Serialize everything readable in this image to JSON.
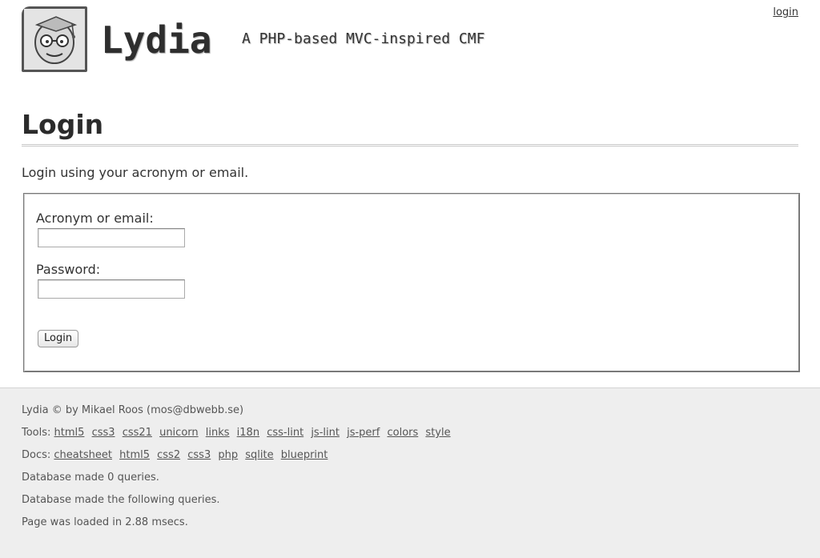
{
  "header": {
    "site_title": "Lydia",
    "slogan": "A PHP-based MVC-inspired CMF",
    "login_link": "login",
    "logo_icon": "nerd-face-with-graduation-cap-icon"
  },
  "main": {
    "title": "Login",
    "intro": "Login using your acronym or email.",
    "form": {
      "acronym_label": "Acronym or email:",
      "acronym_value": "",
      "password_label": "Password:",
      "password_value": "",
      "submit_label": "Login"
    }
  },
  "footer": {
    "copyright": "Lydia © by Mikael Roos (mos@dbwebb.se)",
    "tools_label": "Tools:",
    "tools": [
      "html5",
      "css3",
      "css21",
      "unicorn",
      "links",
      "i18n",
      "css-lint",
      "js-lint",
      "js-perf",
      "colors",
      "style"
    ],
    "docs_label": "Docs:",
    "docs": [
      "cheatsheet",
      "html5",
      "css2",
      "css3",
      "php",
      "sqlite",
      "blueprint"
    ],
    "db_queries": "Database made 0 queries.",
    "db_following": "Database made the following queries.",
    "load_time": "Page was loaded in 2.88 msecs."
  },
  "colors": {
    "background": "#ffffff",
    "footer_background": "#eeeeee",
    "text": "#333333"
  }
}
